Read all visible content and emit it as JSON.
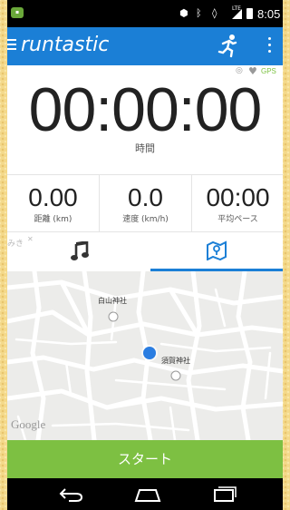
{
  "status_bar": {
    "time": "8:05",
    "network": "LTE",
    "icons": [
      "location-icon",
      "bluetooth-icon",
      "rotate-icon",
      "signal-icon",
      "battery-icon"
    ]
  },
  "app_bar": {
    "logo": "runtastic",
    "actions": [
      "runner-icon",
      "overflow-menu-icon"
    ]
  },
  "gps": {
    "label": "GPS",
    "color": "#7cc242"
  },
  "timer": {
    "value": "00:00:00",
    "label": "時間"
  },
  "metrics": [
    {
      "value": "0.00",
      "label": "距離 (km)"
    },
    {
      "value": "0.0",
      "label": "速度 (km/h)"
    },
    {
      "value": "00:00",
      "label": "平均ペース"
    }
  ],
  "tabs": {
    "items": [
      "music-tab",
      "map-tab"
    ],
    "active": "map-tab",
    "peek_text": "みき"
  },
  "map": {
    "labels": [
      "白山神社",
      "須賀神社"
    ],
    "attribution": "Google"
  },
  "start_button": {
    "label": "スタート",
    "color": "#7dc042"
  },
  "theme": {
    "accent": "#1b7fd6"
  }
}
